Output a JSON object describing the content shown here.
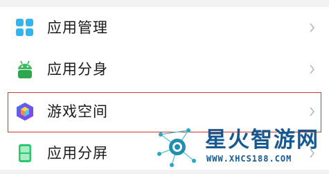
{
  "settings_list": {
    "items": [
      {
        "label": "应用管理",
        "icon": "app-management-grid-icon"
      },
      {
        "label": "应用分身",
        "icon": "app-clone-android-icon"
      },
      {
        "label": "游戏空间",
        "icon": "game-space-cube-icon",
        "highlighted": true
      },
      {
        "label": "应用分屏",
        "icon": "split-screen-icon"
      }
    ]
  },
  "watermark": {
    "title": "星火智游网",
    "url": "WWW.XHCS188.COM",
    "logo": "network-nodes-logo-icon"
  },
  "colors": {
    "highlight_border": "#d2372a",
    "grid_icon": "#34b4ef",
    "android_icon": "#3dbb5d",
    "split_icon": "#2cc66e",
    "watermark": "#16588f"
  }
}
